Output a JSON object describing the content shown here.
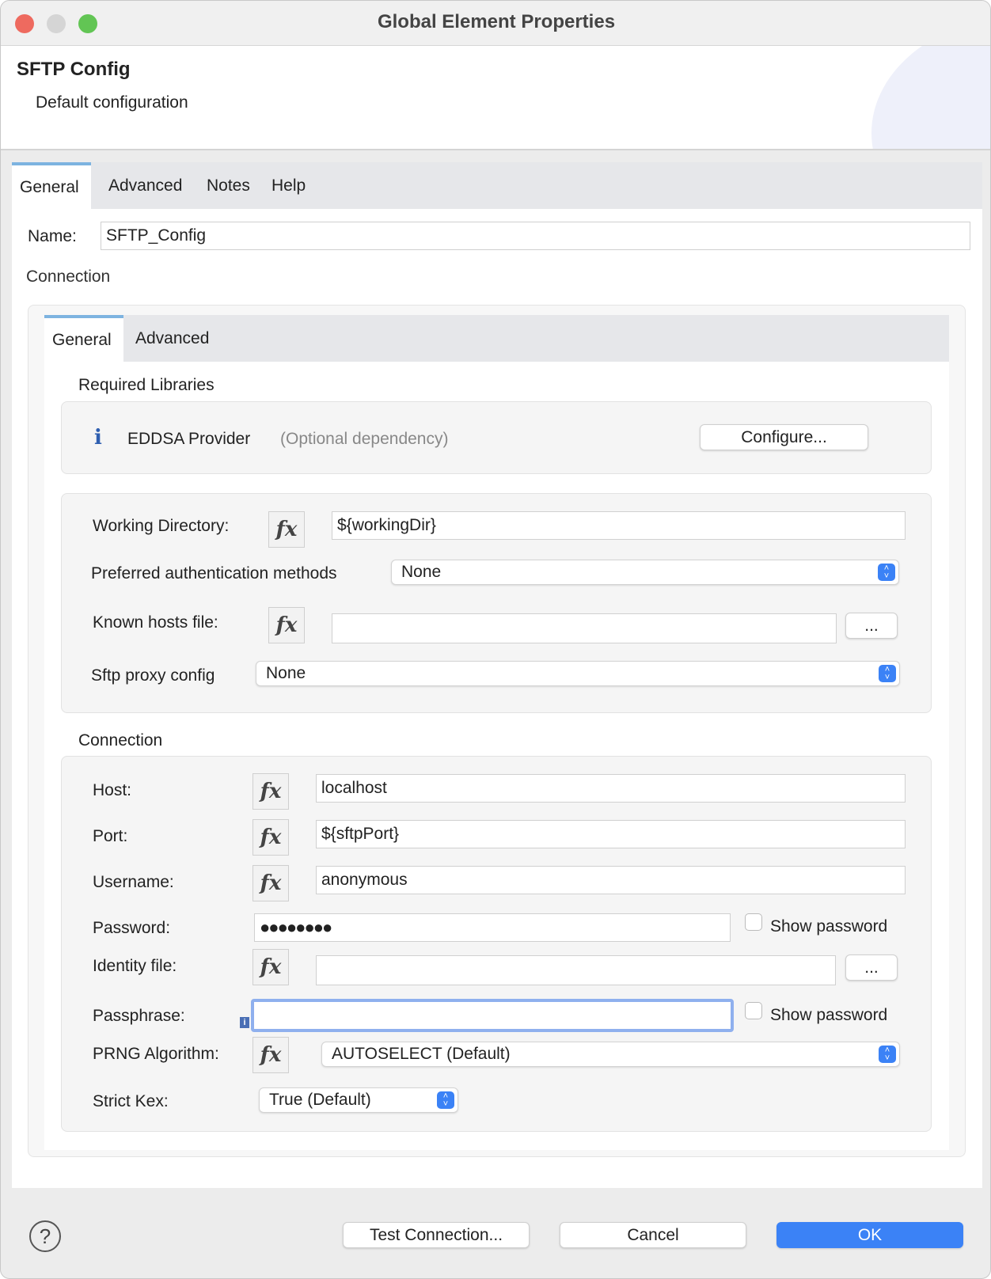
{
  "window": {
    "title": "Global Element Properties"
  },
  "header": {
    "title": "SFTP Config",
    "subtitle": "Default configuration"
  },
  "tabs": [
    "General",
    "Advanced",
    "Notes",
    "Help"
  ],
  "name": {
    "label": "Name:",
    "value": "SFTP_Config"
  },
  "connection_label": "Connection",
  "inner_tabs": [
    "General",
    "Advanced"
  ],
  "required_libraries": {
    "title": "Required Libraries",
    "name": "EDDSA Provider",
    "note": "(Optional dependency)",
    "configure": "Configure..."
  },
  "config": {
    "working_dir_label": "Working Directory:",
    "working_dir_value": "${workingDir}",
    "auth_label": "Preferred authentication methods",
    "auth_value": "None",
    "known_hosts_label": "Known hosts file:",
    "known_hosts_value": "",
    "browse": "...",
    "proxy_label": "Sftp proxy config",
    "proxy_value": "None"
  },
  "conn": {
    "title": "Connection",
    "host_label": "Host:",
    "host_value": "localhost",
    "port_label": "Port:",
    "port_value": "${sftpPort}",
    "username_label": "Username:",
    "username_value": "anonymous",
    "password_label": "Password:",
    "password_value": "●●●●●●●●",
    "show_password": "Show password",
    "identity_label": "Identity file:",
    "identity_value": "",
    "passphrase_label": "Passphrase:",
    "passphrase_value": "",
    "prng_label": "PRNG Algorithm:",
    "prng_value": "AUTOSELECT (Default)",
    "kex_label": "Strict Kex:",
    "kex_value": "True (Default)"
  },
  "fx": "fx",
  "footer": {
    "help": "?",
    "test": "Test Connection...",
    "cancel": "Cancel",
    "ok": "OK"
  },
  "colors": {
    "accent": "#3b82f6",
    "tab_indicator": "#7db3e0"
  }
}
